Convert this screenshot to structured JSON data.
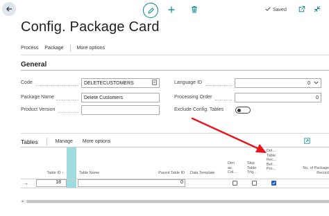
{
  "toolbar": {
    "saved_label": "Saved",
    "icons": [
      "arrow-left-icon",
      "pencil-icon",
      "plus-icon",
      "trash-icon",
      "checkmark-icon",
      "open-in-new-icon",
      "collapse-icon"
    ]
  },
  "page": {
    "title": "Config. Package Card"
  },
  "actions": {
    "process": "Process",
    "package": "Package",
    "more_options": "More options"
  },
  "general": {
    "title": "General",
    "code_label": "Code",
    "code_value": "DELETECUSTOMERS",
    "package_name_label": "Package Name",
    "package_name_value": "Delete Customers",
    "product_version_label": "Product Version",
    "product_version_value": "",
    "language_id_label": "Language ID",
    "language_id_value": "0",
    "processing_order_label": "Processing Order",
    "processing_order_value": "0",
    "exclude_config_tables_label": "Exclude Config. Tables",
    "exclude_config_tables_on": false
  },
  "tables": {
    "title": "Tables",
    "manage": "Manage",
    "more_options": "More options",
    "columns": {
      "table_id": "Table ID ↑",
      "table_name": "Table Name",
      "parent_table_id": "Parent Table ID",
      "data_template": "Data Template",
      "dim_as_col_l1": "Dim",
      "dim_as_col_l2": "as",
      "dim_as_col_l3": "Col...",
      "skip_table_trig_l1": "Skip",
      "skip_table_trig_l2": "Table",
      "skip_table_trig_l3": "Trig...",
      "delete_table_l1": "Del...",
      "delete_table_l2": "Table",
      "delete_table_l3": "Rec...",
      "delete_table_l4": "Bef...",
      "delete_table_l5": "Pro...",
      "no_of_package_l1": "No. of Package",
      "no_of_package_l2": "Record"
    },
    "rows": [
      {
        "arrow": "→",
        "table_id": "18",
        "table_name": "",
        "parent_table_id": "0",
        "data_template": "",
        "dim_as_columns": false,
        "skip_table_triggers": false,
        "delete_before_processing": true
      }
    ]
  },
  "colors": {
    "accent": "#008489",
    "checkbox_checked": "#1c5ccf",
    "annotation_arrow": "#e8141e"
  }
}
